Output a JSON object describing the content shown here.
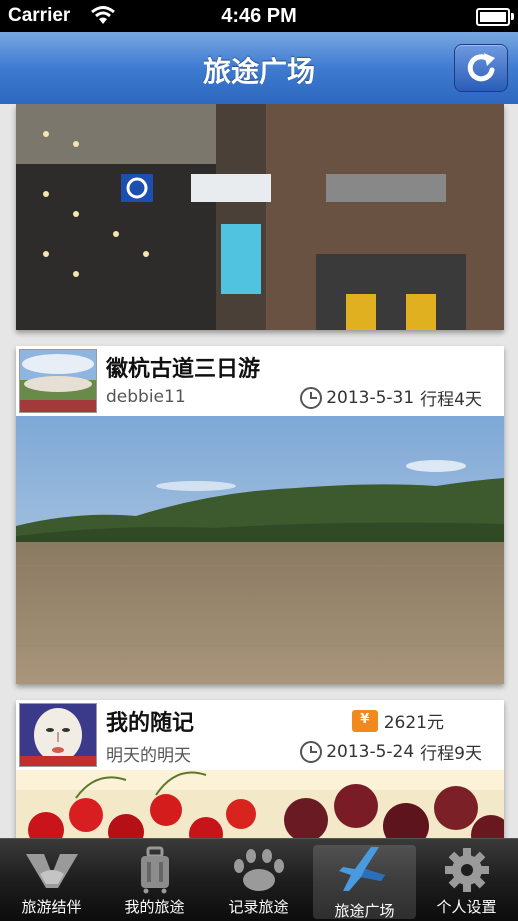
{
  "status": {
    "carrier": "Carrier",
    "time": "4:46 PM"
  },
  "nav": {
    "title": "旅途广场"
  },
  "cards": [
    {
      "title": "徽杭古道三日游",
      "user": "debbie11",
      "date": "2013-5-31",
      "duration": "行程4天"
    },
    {
      "title": "我的随记",
      "user": "明天的明天",
      "price": "2621元",
      "date": "2013-5-24",
      "duration": "行程9天"
    }
  ],
  "tabs": [
    {
      "label": "旅游结伴",
      "icon": "handshake-icon"
    },
    {
      "label": "我的旅途",
      "icon": "luggage-icon"
    },
    {
      "label": "记录旅途",
      "icon": "footprint-icon"
    },
    {
      "label": "旅途广场",
      "icon": "plane-icon",
      "active": true
    },
    {
      "label": "个人设置",
      "icon": "gear-icon"
    }
  ],
  "colors": {
    "nav": "#3f7bd1",
    "price_icon": "#f08a1e",
    "tabbar": "#1e1e1e"
  }
}
